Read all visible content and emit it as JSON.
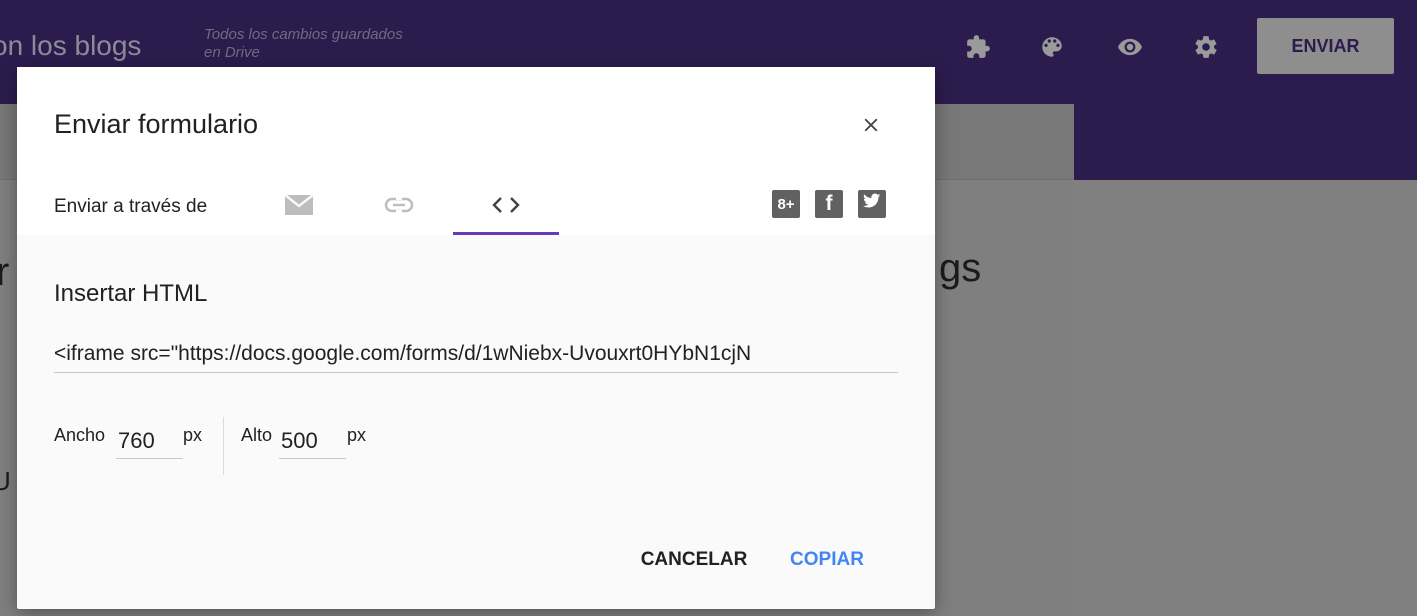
{
  "app": {
    "title": "on los blogs",
    "status": [
      "Todos los cambios guardados",
      "en Drive"
    ],
    "send_button": "ENVIAR",
    "icons": [
      "puzzle-icon",
      "palette-icon",
      "eye-icon",
      "gear-icon"
    ],
    "bg_title_fragment": "r",
    "bg_title_fragment_right": "gs",
    "bg_body_fragment": "U"
  },
  "dialog": {
    "title": "Enviar formulario",
    "close_icon": "close-icon",
    "send_via_label": "Enviar a través de",
    "tabs": [
      {
        "name": "email",
        "icon": "mail-icon",
        "selected": false
      },
      {
        "name": "link",
        "icon": "link-icon",
        "selected": false
      },
      {
        "name": "embed",
        "icon": "code-icon",
        "selected": true
      }
    ],
    "social": [
      {
        "name": "google-plus",
        "label": "8+"
      },
      {
        "name": "facebook",
        "label": "f"
      },
      {
        "name": "twitter",
        "label": "t"
      }
    ],
    "section_title": "Insertar HTML",
    "embed_code": "<iframe src=\"https://docs.google.com/forms/d/1wNiebx-Uvouxrt0HYbN1cjN",
    "width_label": "Ancho",
    "width_value": "760",
    "height_label": "Alto",
    "height_value": "500",
    "unit": "px",
    "cancel_label": "CANCELAR",
    "copy_label": "COPIAR"
  },
  "colors": {
    "header": "#2c1c4e",
    "accent": "#673ab7",
    "link_blue": "#4285f4"
  }
}
